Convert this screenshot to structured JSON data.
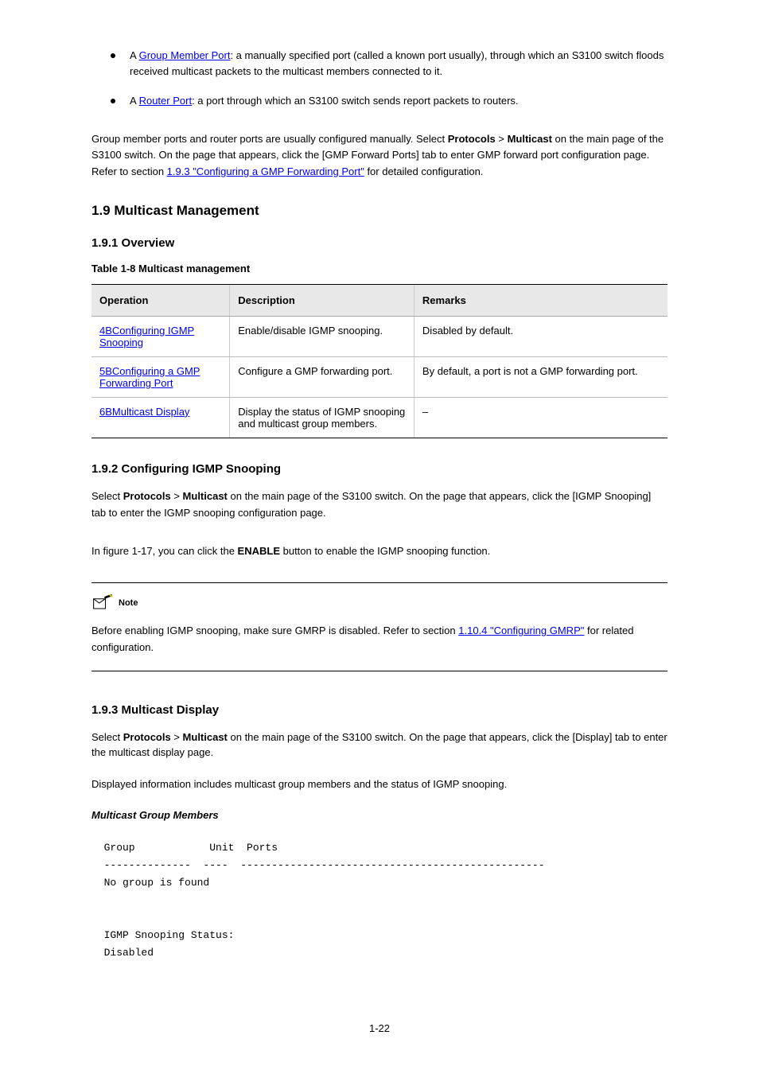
{
  "bullets": [
    {
      "prefix": "A ",
      "ref_text": "Group Member Port",
      "suffix_a": ": a manually specified port (called a known port usually), through which an ",
      "suffix_b": "switch floods received multicast packets to the multicast members connected to it."
    },
    {
      "prefix": "A ",
      "ref_text": "Router Port",
      "suffix_a": ": a port through which an ",
      "suffix_b": "switch sends report packets to routers."
    }
  ],
  "paragraphs": {
    "p1_a": "Group member ports and router ports are usually configured manually. Select ",
    "p1_b_strong": "Protocols",
    "p1_c": " > ",
    "p1_d_strong": "Multicast",
    "p1_e": " on the main page of the ",
    "p1_f": "switch. On the page that appears, click the [GMP Forward Ports] tab to enter GMP forward port configuration page. Refer to section ",
    "p1_link_text": "1.9.3 ",
    "p1_link_text2": "\"Configuring a GMP Forwarding Port\"",
    "p1_g": " for detailed configuration."
  },
  "section_header": "1.9  Multicast Management",
  "sub_header_1": "1.9.1  Overview",
  "table_caption": "Table 1-8 Multicast management",
  "table": {
    "headers": [
      "Operation",
      "Description",
      "Remarks"
    ],
    "rows": [
      {
        "op_link": "4BConfiguring IGMP Snooping",
        "desc": "Enable/disable IGMP snooping.",
        "remarks": "Disabled by default."
      },
      {
        "op_link": "5BConfiguring a GMP Forwarding Port",
        "desc": "Configure a GMP forwarding port.",
        "remarks": "By default, a port is not a GMP forwarding port."
      },
      {
        "op_link": "6BMulticast Display",
        "desc": "Display the status of IGMP snooping and multicast group members.",
        "remarks": "–"
      }
    ]
  },
  "sub_header_2": "1.9.2  Configuring IGMP Snooping",
  "config_section": {
    "p1_a": "Select ",
    "p1_b_strong": "Protocols",
    "p1_c": " > ",
    "p1_d_strong": "Multicast",
    "p1_e": " on the main page of the ",
    "p1_f": "switch. On the page that appears, click the [IGMP Snooping] tab to enter the IGMP snooping configuration page.",
    "p2_a": "In figure 1-17, you can click the ",
    "p2_b_strong": "ENABLE",
    "p2_c": " button to enable the IGMP snooping function."
  },
  "note": {
    "label": "Note",
    "body_a": "Before enabling IGMP snooping, make sure GMRP is disabled. Refer to section ",
    "body_link1": "1.10.4 ",
    "body_link2": "\"Configuring GMRP\"",
    "body_b": " for related configuration."
  },
  "display_section": {
    "header": "1.9.3  Multicast Display",
    "p1_a": "Select ",
    "p1_b_strong": "Protocols",
    "p1_c": " > ",
    "p1_d_strong": "Multicast",
    "p1_e": " on the main page of the ",
    "p1_f": "switch. On the page that appears, click the [Display] tab to enter the multicast display page.",
    "p2": "Displayed information includes multicast group members and the status of IGMP snooping.",
    "p3_label": "Multicast Group Members",
    "terminal": "  Group            Unit  Ports\n  --------------  ----  -------------------------------------------------\n  No group is found\n\n\n  IGMP Snooping Status:\n  Disabled"
  },
  "page_number": "1-22",
  "product_code": "S3100"
}
